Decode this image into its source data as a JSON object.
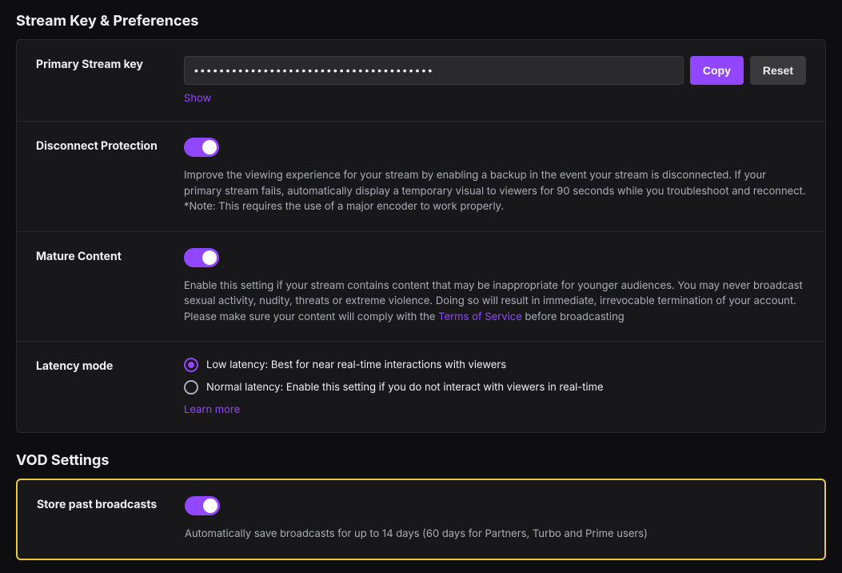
{
  "page": {
    "title": "Stream Key & Preferences",
    "vod_title": "VOD Settings"
  },
  "stream_key": {
    "label": "Primary Stream key",
    "value": "••••••••••••••••••••••••••••••••••••••",
    "copy_button": "Copy",
    "reset_button": "Reset",
    "show_link": "Show"
  },
  "disconnect_protection": {
    "label": "Disconnect Protection",
    "enabled": true,
    "description": "Improve the viewing experience for your stream by enabling a backup in the event your stream is disconnected. If your primary stream fails, automatically display a temporary visual to viewers for 90 seconds while you troubleshoot and reconnect. *Note: This requires the use of a major encoder to work properly."
  },
  "mature_content": {
    "label": "Mature Content",
    "enabled": true,
    "description_before": "Enable this setting if your stream contains content that may be inappropriate for younger audiences. You may never broadcast sexual activity, nudity, threats or extreme violence. Doing so will result in immediate, irrevocable termination of your account. Please make sure your content will comply with the ",
    "terms_link_text": "Terms of Service",
    "description_after": " before broadcasting"
  },
  "latency_mode": {
    "label": "Latency mode",
    "options": [
      {
        "id": "low",
        "label": "Low latency: Best for near real-time interactions with viewers",
        "selected": true
      },
      {
        "id": "normal",
        "label": "Normal latency: Enable this setting if you do not interact with viewers in real-time",
        "selected": false
      }
    ],
    "learn_more": "Learn more"
  },
  "vod_settings": {
    "store_broadcasts": {
      "label": "Store past broadcasts",
      "enabled": true,
      "description": "Automatically save broadcasts for up to 14 days (60 days for Partners, Turbo and Prime users)"
    }
  },
  "colors": {
    "purple": "#9147ff",
    "yellow": "#e8c84a"
  }
}
